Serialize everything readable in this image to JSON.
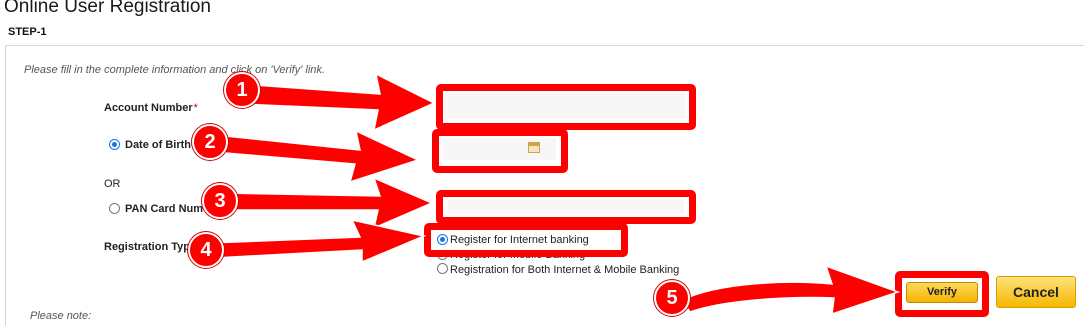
{
  "page": {
    "title": "Online User Registration",
    "step": "STEP-1",
    "instructions": "Please fill in the complete information and click on 'Verify' link.",
    "note": "Please note:"
  },
  "form": {
    "account_number_label": "Account Number",
    "required_marker": "*",
    "date_of_birth_label": "Date of Birth",
    "date_of_birth_selected": true,
    "or_label": "OR",
    "pan_card_label": "PAN Card Num",
    "pan_card_selected": false,
    "registration_type_label": "Registration Type",
    "registration_options": [
      {
        "label": "Register for Internet banking",
        "selected": true
      },
      {
        "label": "Register for Mobile Banking",
        "selected": false
      },
      {
        "label": "Registration for Both Internet & Mobile Banking",
        "selected": false
      }
    ]
  },
  "buttons": {
    "verify": "Verify",
    "cancel": "Cancel"
  },
  "annotations": {
    "color": "#ff0000",
    "steps": [
      "1",
      "2",
      "3",
      "4",
      "5"
    ]
  },
  "icons": {
    "calendar": "calendar-icon"
  }
}
